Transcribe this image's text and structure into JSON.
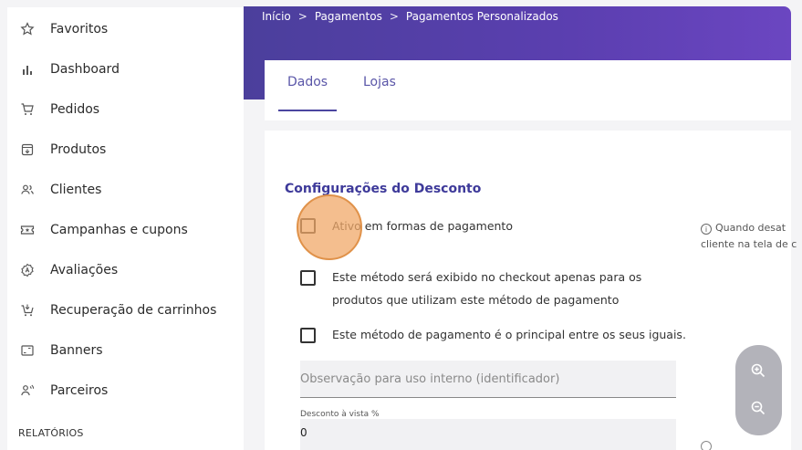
{
  "sidebar": {
    "items": [
      {
        "label": "Favoritos",
        "icon": "star-icon"
      },
      {
        "label": "Dashboard",
        "icon": "bar-chart-icon"
      },
      {
        "label": "Pedidos",
        "icon": "cart-icon"
      },
      {
        "label": "Produtos",
        "icon": "product-box-icon"
      },
      {
        "label": "Clientes",
        "icon": "users-icon"
      },
      {
        "label": "Campanhas e cupons",
        "icon": "coupon-icon"
      },
      {
        "label": "Avaliações",
        "icon": "review-badge-icon"
      },
      {
        "label": "Recuperação de carrinhos",
        "icon": "cart-recovery-icon"
      },
      {
        "label": "Banners",
        "icon": "banner-icon"
      },
      {
        "label": "Parceiros",
        "icon": "partner-icon"
      }
    ],
    "section_label": "RELATÓRIOS"
  },
  "breadcrumb": [
    "Início",
    "Pagamentos",
    "Pagamentos Personalizados"
  ],
  "breadcrumb_separator": ">",
  "tabs": [
    {
      "label": "Dados",
      "active": true
    },
    {
      "label": "Lojas",
      "active": false
    }
  ],
  "form": {
    "section_title": "Configurações do Desconto",
    "checkbox_active": {
      "label": "Ativo em formas de pagamento",
      "checked": false
    },
    "checkbox_products": {
      "line1": "Este método será exibido no checkout apenas para os",
      "line2": "produtos que utilizam este método de pagamento",
      "checked": false
    },
    "checkbox_principal": {
      "label": "Este método de pagamento é o principal entre os seus iguais.",
      "checked": false
    },
    "hint": {
      "line1": "Quando desat",
      "line2": "cliente na tela de c"
    },
    "observation_placeholder": "Observação para uso interno (identificador)",
    "discount_label": "Desconto à vista %",
    "discount_value": "0"
  },
  "colors": {
    "accent": "#4b45a0",
    "header_start": "#4b3f9c",
    "header_end": "#6b46c1",
    "cursor": "#f0a868"
  }
}
